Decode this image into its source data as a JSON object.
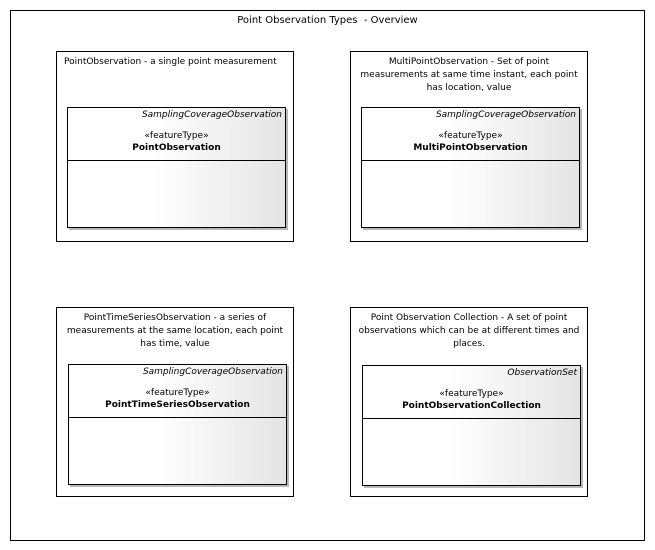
{
  "diagram": {
    "title": "Point Observation Types  - Overview"
  },
  "packages": [
    {
      "note": "PointObservation - a single point measurement",
      "class": {
        "parent": "SamplingCoverageObservation",
        "stereotype": "«featureType»",
        "name": "PointObservation"
      }
    },
    {
      "note": "MultiPointObservation - Set of point\nmeasurements at same time instant, each point\nhas location, value",
      "class": {
        "parent": "SamplingCoverageObservation",
        "stereotype": "«featureType»",
        "name": "MultiPointObservation"
      }
    },
    {
      "note": "PointTimeSeriesObservation - a series of\nmeasurements at the same location, each point\nhas time, value",
      "class": {
        "parent": "SamplingCoverageObservation",
        "stereotype": "«featureType»",
        "name": "PointTimeSeriesObservation"
      }
    },
    {
      "note": "Point Observation Collection - A set of point\nobservations which can be at different times and\nplaces.",
      "class": {
        "parent": "ObservationSet",
        "stereotype": "«featureType»",
        "name": "PointObservationCollection"
      }
    }
  ]
}
